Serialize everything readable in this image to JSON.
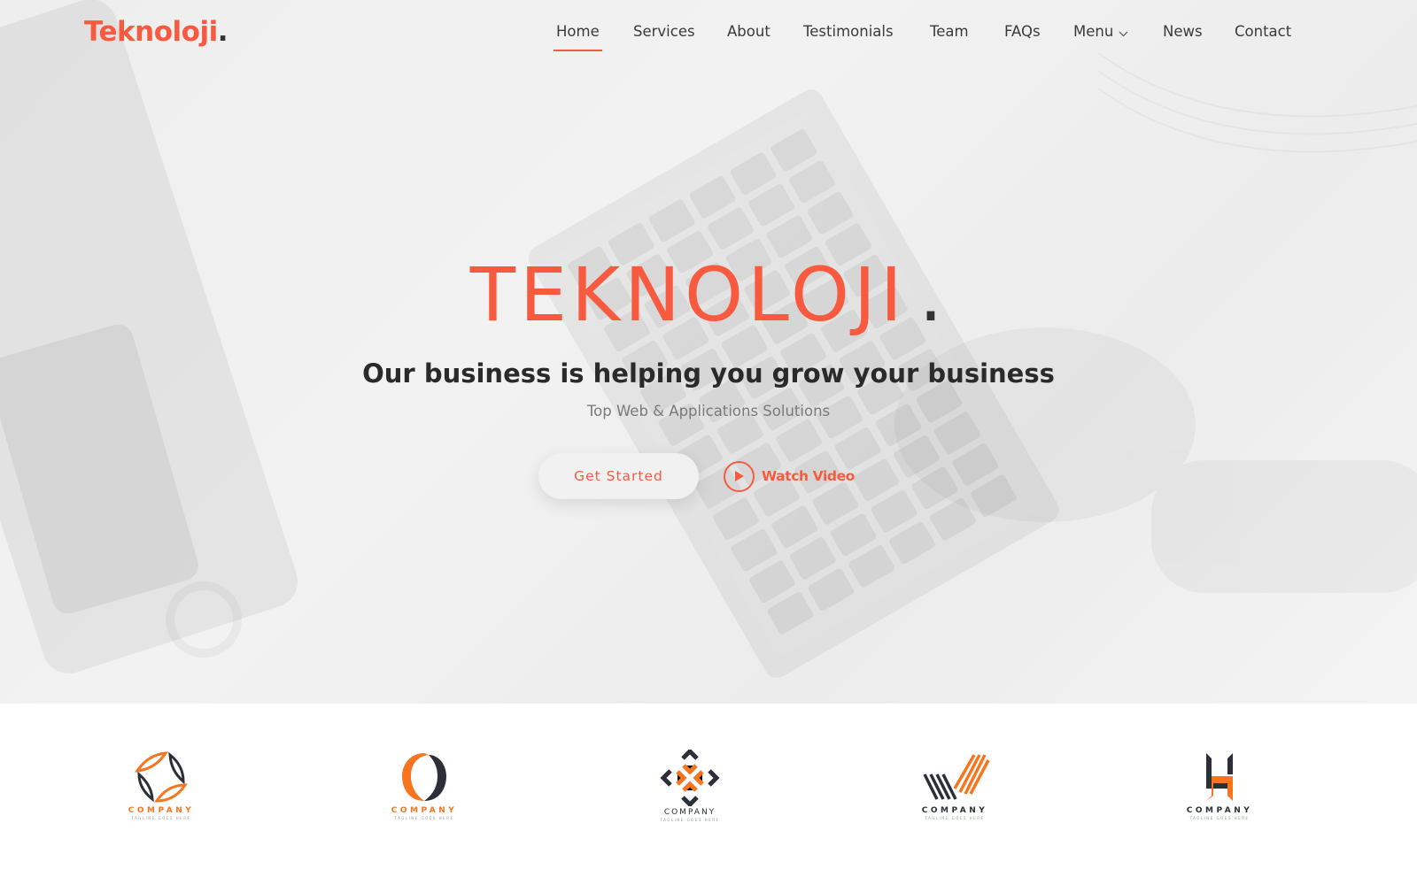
{
  "brand": {
    "name": "Teknoloji",
    "dot": ".",
    "accent_color": "#f75a3f",
    "dark_color": "#333333"
  },
  "nav": {
    "items": [
      {
        "label": "Home",
        "active": true
      },
      {
        "label": "Services",
        "active": false
      },
      {
        "label": "About",
        "active": false
      },
      {
        "label": "Testimonials",
        "active": false
      },
      {
        "label": "Team",
        "active": false
      },
      {
        "label": "FAQs",
        "active": false
      },
      {
        "label": "Menu",
        "active": false,
        "has_dropdown": true
      },
      {
        "label": "News",
        "active": false
      },
      {
        "label": "Contact",
        "active": false
      }
    ]
  },
  "hero": {
    "title": "TEKNOLOJI",
    "title_dot": ".",
    "subtitle": "Our business is helping you grow your business",
    "tagline": "Top Web & Applications Solutions",
    "primary_button": "Get Started",
    "video_button": "Watch Video",
    "video_icon": "play-icon"
  },
  "clients": {
    "logos": [
      {
        "name": "COMPANY",
        "tagline": "Tagline goes here",
        "icon": "leaf-diamond-logo",
        "name_color": "#f7751f"
      },
      {
        "name": "COMPANY",
        "tagline": "Tagline goes here",
        "icon": "ring-logo",
        "name_color": "#f7751f"
      },
      {
        "name": "COMPANY",
        "tagline": "Tagline goes here",
        "icon": "diamond-cross-logo",
        "name_color": "#2b2f38"
      },
      {
        "name": "COMPANY",
        "tagline": "Tagline goes here",
        "icon": "stripes-check-logo",
        "name_color": "#2b2f38"
      },
      {
        "name": "COMPANY",
        "tagline": "Tagline goes here",
        "icon": "h-letter-logo",
        "name_color": "#2b2f38"
      }
    ]
  }
}
